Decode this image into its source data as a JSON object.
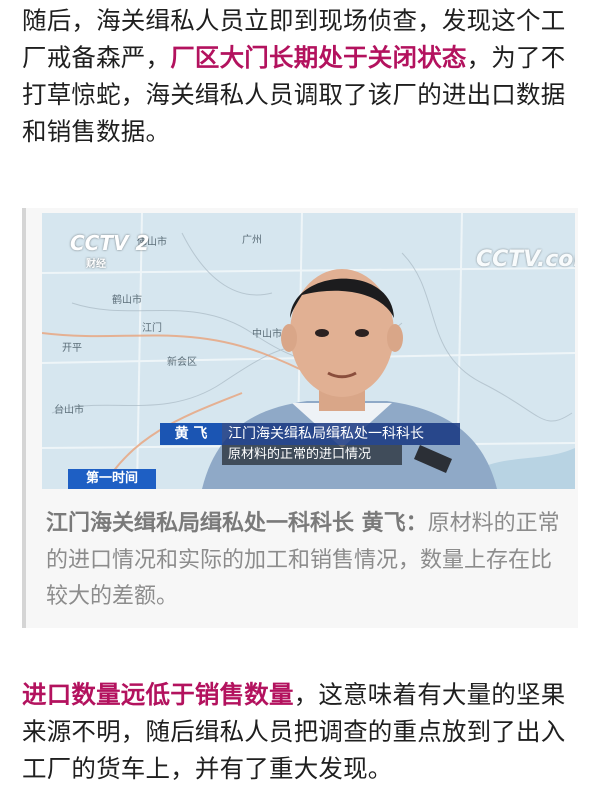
{
  "paragraph1": {
    "text_before": "随后，海关缉私人员立即到现场侦查，发现这个工厂戒备森严，",
    "highlight": "厂区大门长期处于关闭状态",
    "text_after": "，为了不打草惊蛇，海关缉私人员调取了该厂的进出口数据和销售数据。"
  },
  "video": {
    "channel_logo": "CCTV 2",
    "channel_sub": "财经",
    "watermark": "CCTV.com",
    "map_labels": [
      "佛山市",
      "广州",
      "鹤山市",
      "江门",
      "中山市",
      "新会区",
      "台山市",
      "开平"
    ],
    "person_name": "黄 飞",
    "person_title": "江门海关缉私局缉私处一科科长",
    "subtitle": "原材料的正常的进口情况",
    "program": "第一时间"
  },
  "quote": {
    "speaker": "江门海关缉私局缉私处一科科长 黄飞：",
    "text": "原材料的正常的进口情况和实际的加工和销售情况，数量上存在比较大的差额。"
  },
  "paragraph2": {
    "highlight": "进口数量远低于销售数量",
    "text_after": "，这意味着有大量的坚果来源不明，随后缉私人员把调查的重点放到了出入工厂的货车上，并有了重大发现。"
  },
  "colors": {
    "highlight": "#b3125e",
    "quote_text": "#8c8c8c",
    "name_tag": "#1b55b3"
  }
}
